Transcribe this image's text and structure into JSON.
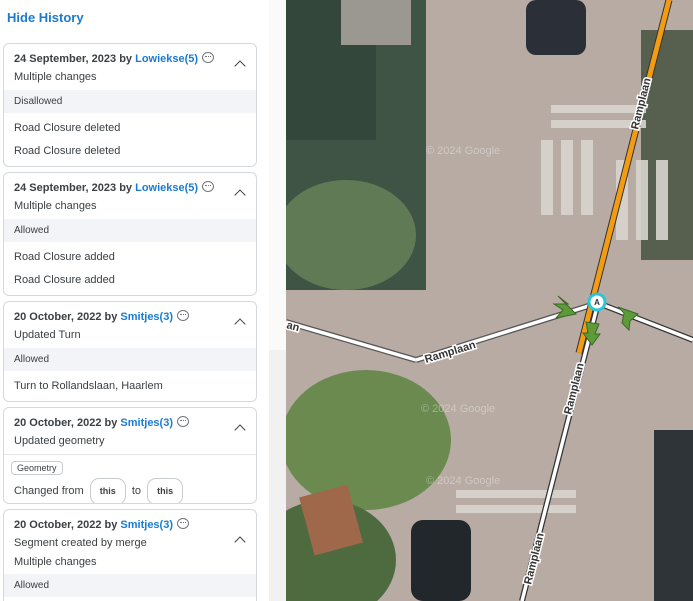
{
  "panel": {
    "hide_history": "Hide History",
    "entries": [
      {
        "date": "24 September, 2023",
        "by": "by",
        "user": "Lowiekse(5)",
        "summary": "Multiple changes",
        "status": "Disallowed",
        "rows": [
          "Road Closure deleted",
          "Road Closure deleted"
        ]
      },
      {
        "date": "24 September, 2023",
        "by": "by",
        "user": "Lowiekse(5)",
        "summary": "Multiple changes",
        "status": "Allowed",
        "rows": [
          "Road Closure added",
          "Road Closure added"
        ]
      },
      {
        "date": "20 October, 2022",
        "by": "by",
        "user": "Smitjes(3)",
        "summary": "Updated Turn",
        "status": "Allowed",
        "rows": [
          "Turn to Rollandslaan, Haarlem"
        ]
      },
      {
        "date": "20 October, 2022",
        "by": "by",
        "user": "Smitjes(3)",
        "summary": "Updated geometry",
        "tag": "Geometry",
        "changed_from": "Changed from",
        "pill_a": "this",
        "to": "to",
        "pill_b": "this"
      },
      {
        "date": "20 October, 2022",
        "by": "by",
        "user": "Smitjes(3)",
        "summary": "Segment created by merge",
        "summary2": "Multiple changes",
        "status": "Allowed"
      }
    ]
  },
  "map": {
    "watermark": "© 2024 Google",
    "street_names": [
      "Ramplaan",
      "Ramplaan",
      "Ramplaan",
      "Ramplaan",
      "an"
    ],
    "node_label": "A",
    "colors": {
      "selected_segment": "#f39c12",
      "arrow": "#5d9b3a",
      "node": "#2ec4d8"
    }
  }
}
